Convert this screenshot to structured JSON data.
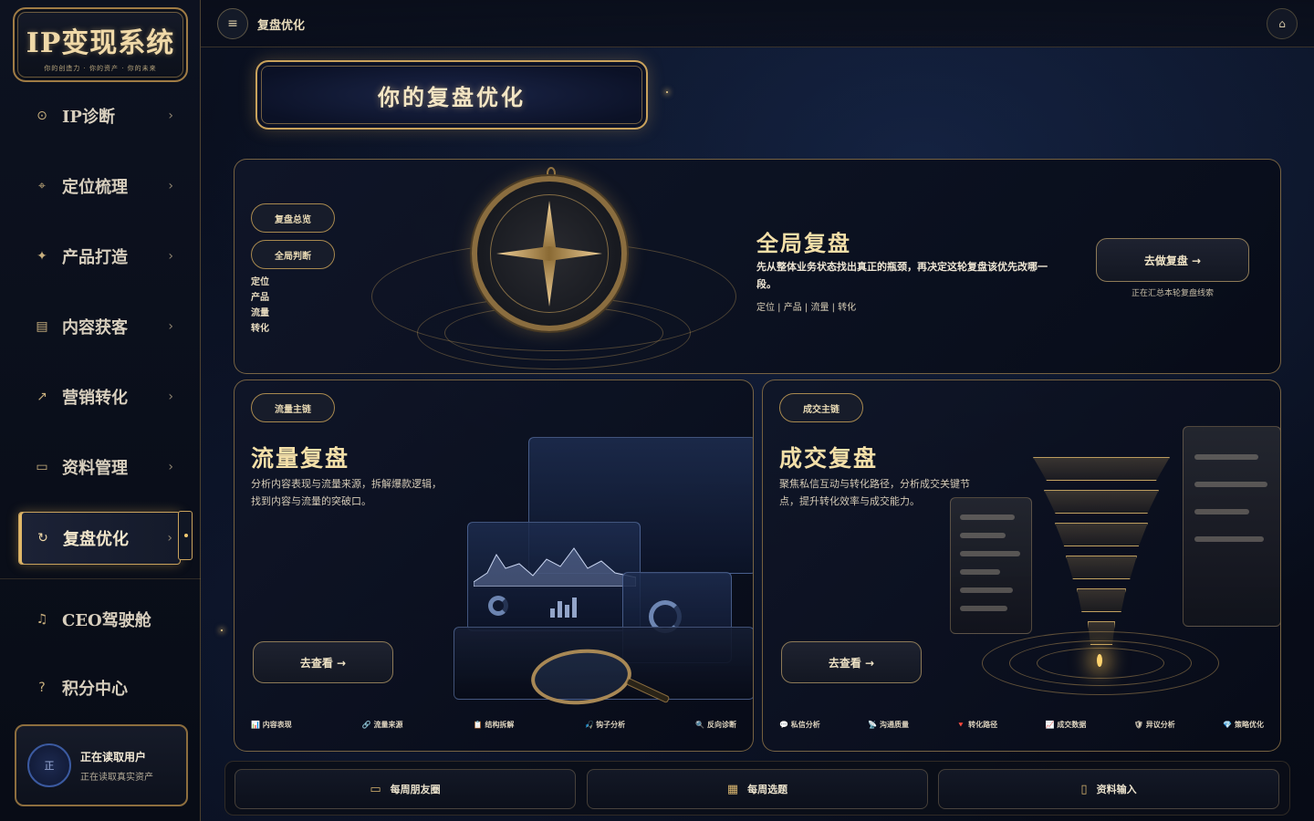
{
  "app": {
    "logo_title": "IP变现系统",
    "logo_subtitle": "你的创造力 · 你的资产 · 你的未来"
  },
  "sidebar": {
    "items": [
      {
        "label": "IP诊断",
        "icon": "target-icon",
        "glyph": "⊙"
      },
      {
        "label": "定位梳理",
        "icon": "location-pin-icon",
        "glyph": "⌖"
      },
      {
        "label": "产品打造",
        "icon": "sparkle-icon",
        "glyph": "✦"
      },
      {
        "label": "内容获客",
        "icon": "document-icon",
        "glyph": "▤"
      },
      {
        "label": "营销转化",
        "icon": "trend-icon",
        "glyph": "↗"
      },
      {
        "label": "资料管理",
        "icon": "folder-icon",
        "glyph": "▭"
      },
      {
        "label": "复盘优化",
        "icon": "refresh-icon",
        "glyph": "↻",
        "active": true
      }
    ],
    "extra": [
      {
        "label": "CEO驾驶舱",
        "icon": "bell-icon",
        "glyph": "♫"
      },
      {
        "label": "积分中心",
        "icon": "question-icon",
        "glyph": "?"
      }
    ],
    "chevron": "›",
    "user": {
      "avatar_text": "正",
      "name": "正在读取用户",
      "status": "正在读取真实资产"
    }
  },
  "topbar": {
    "breadcrumb": "复盘优化",
    "menu_glyph": "≡",
    "home_glyph": "⌂"
  },
  "page": {
    "title": "你的复盘优化"
  },
  "global_card": {
    "tabs": [
      "复盘总览",
      "全局判断"
    ],
    "side_tags": [
      "定位",
      "产品",
      "流量",
      "转化"
    ],
    "title": "全局复盘",
    "description": "先从整体业务状态找出真正的瓶颈，再决定这轮复盘该优先改哪一段。",
    "tags": "定位 | 产品 | 流量 | 转化",
    "cta": "去做复盘 →",
    "hint": "正在汇总本轮复盘线索"
  },
  "traffic_card": {
    "badge": "流量主链",
    "title": "流量复盘",
    "description": "分析内容表现与流量来源，拆解爆款逻辑，找到内容与流量的突破口。",
    "cta": "去查看 →",
    "footer": [
      "📊 内容表现",
      "🔗 流量来源",
      "📋 结构拆解",
      "🎣 钩子分析",
      "🔍 反向诊断"
    ]
  },
  "deal_card": {
    "badge": "成交主链",
    "title": "成交复盘",
    "description": "聚焦私信互动与转化路径，分析成交关键节点，提升转化效率与成交能力。",
    "cta": "去查看 →",
    "footer": [
      "💬 私信分析",
      "📡 沟通质量",
      "🔻 转化路径",
      "📈 成交数据",
      "🛡 异议分析",
      "💎 策略优化"
    ]
  },
  "bottombar": {
    "items": [
      {
        "label": "每周朋友圈",
        "icon": "chat-icon",
        "glyph": "▭"
      },
      {
        "label": "每周选题",
        "icon": "calendar-icon",
        "glyph": "▦"
      },
      {
        "label": "资料输入",
        "icon": "file-icon",
        "glyph": "▯"
      }
    ]
  },
  "colors": {
    "accent_gold": "#c9a25c",
    "background": "#070b16",
    "title_gold": "#f3dfa8"
  }
}
